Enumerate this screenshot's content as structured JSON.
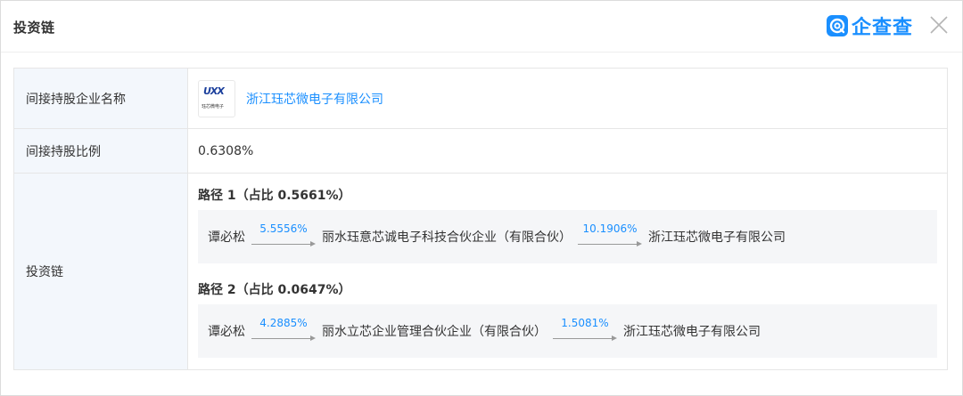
{
  "modal": {
    "title": "投资链",
    "brand": {
      "name": "企查查",
      "icon": "qichacha-logo-icon",
      "color": "#1a8fff"
    },
    "close_icon": "close-icon"
  },
  "rows": {
    "indirect_company": {
      "label": "间接持股企业名称",
      "logo_text": "UXX",
      "logo_subtext": "珏芯微电子",
      "company_name": "浙江珏芯微电子有限公司"
    },
    "indirect_ratio": {
      "label": "间接持股比例",
      "value": "0.6308%"
    },
    "investment_chain": {
      "label": "投资链",
      "paths": [
        {
          "title": "路径 1（占比 0.5661%）",
          "start": "谭必松",
          "steps": [
            {
              "percent": "5.5556%",
              "entity": "丽水珏意芯诚电子科技合伙企业（有限合伙）"
            },
            {
              "percent": "10.1906%",
              "entity": "浙江珏芯微电子有限公司"
            }
          ]
        },
        {
          "title": "路径 2（占比 0.0647%）",
          "start": "谭必松",
          "steps": [
            {
              "percent": "4.2885%",
              "entity": "丽水立芯企业管理合伙企业（有限合伙）"
            },
            {
              "percent": "1.5081%",
              "entity": "浙江珏芯微电子有限公司"
            }
          ]
        }
      ]
    }
  },
  "colors": {
    "accent": "#1a8fff",
    "label_bg": "#f3f7fc",
    "path_bg": "#f5f6f8"
  }
}
